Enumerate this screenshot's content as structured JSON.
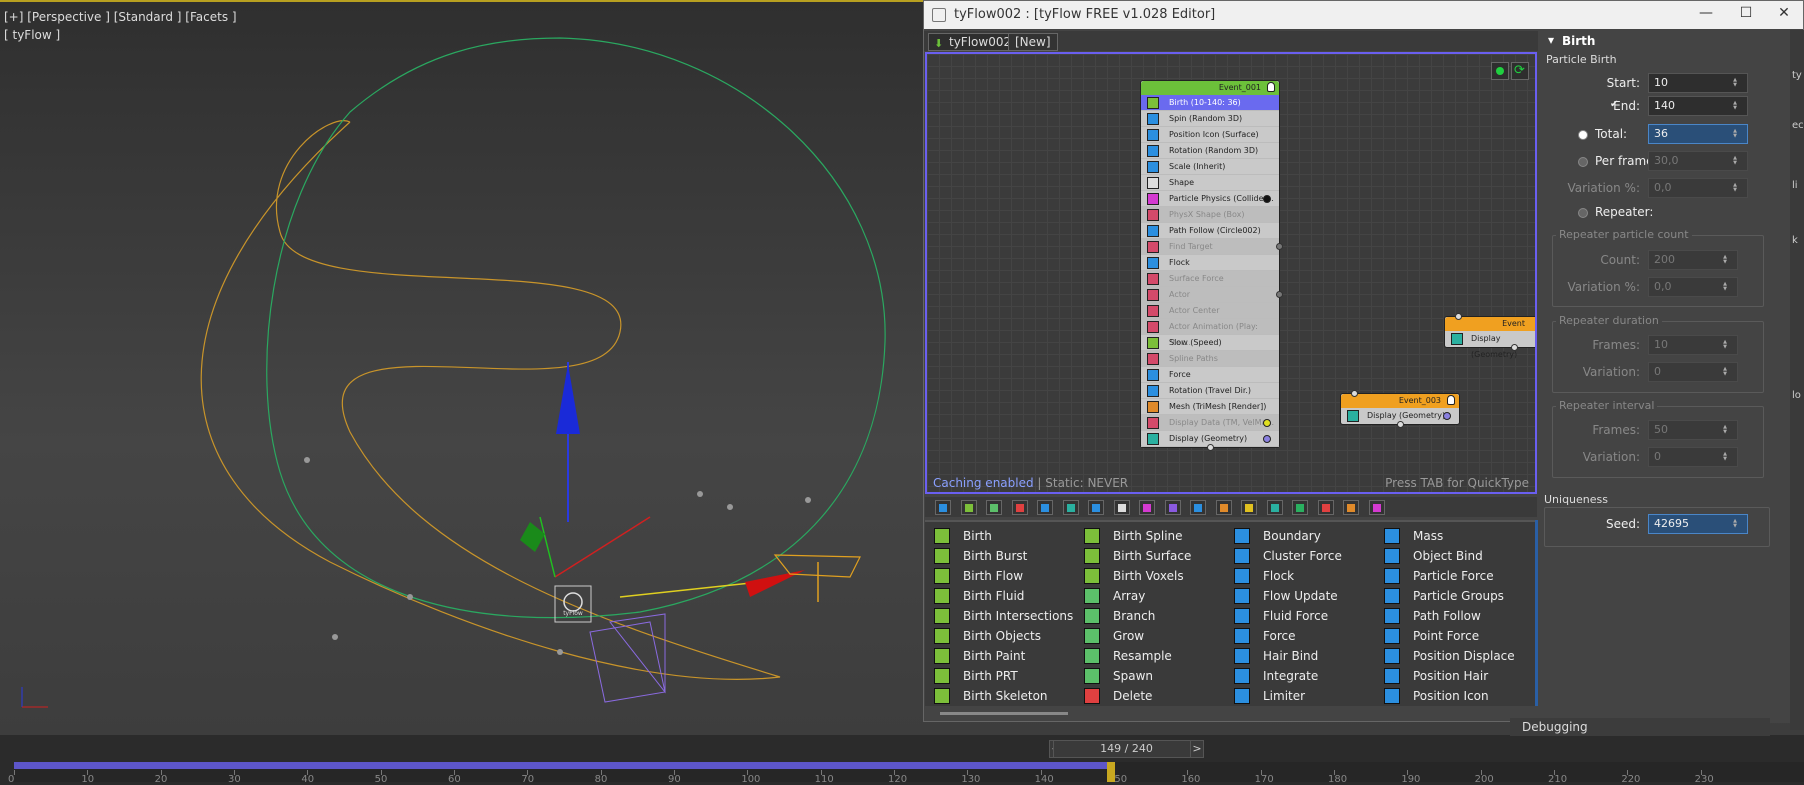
{
  "viewport": {
    "label": "[+] [Perspective ] [Standard ] [Facets ]",
    "sublabel": "[ tyFlow ]",
    "icon_label": "tyFlow"
  },
  "timeline": {
    "frame_display": "149 / 240",
    "prev": "<",
    "next": ">",
    "current_frame": 149,
    "total_frames": 240,
    "ticks": [
      "0",
      "10",
      "20",
      "30",
      "40",
      "50",
      "60",
      "70",
      "80",
      "90",
      "100",
      "110",
      "120",
      "130",
      "140",
      "150",
      "160",
      "170",
      "180",
      "190",
      "200",
      "210",
      "220",
      "230"
    ]
  },
  "window": {
    "title": "tyFlow002 : [tyFlow FREE v1.028 Editor]",
    "min": "—",
    "max": "☐",
    "close": "✕",
    "tabs": [
      "tyFlow002",
      "[New]"
    ]
  },
  "graph": {
    "footer_left_a": "Caching enabled",
    "footer_left_b": " | Static: NEVER",
    "footer_right": "Press TAB for QuickType",
    "event1": {
      "title": "Event_001",
      "color": "#6cc03a",
      "operators": [
        {
          "label": "Birth (10-140: 36)",
          "state": "sel",
          "icon": "#7cbf3a"
        },
        {
          "label": "Spin (Random 3D)",
          "state": "on",
          "icon": "#2b8fe0"
        },
        {
          "label": "Position Icon (Surface)",
          "state": "on",
          "icon": "#2b8fe0"
        },
        {
          "label": "Rotation (Random 3D)",
          "state": "on",
          "icon": "#2b8fe0"
        },
        {
          "label": "Scale (Inherit)",
          "state": "on",
          "icon": "#2b8fe0"
        },
        {
          "label": "Shape",
          "state": "on",
          "icon": "#dddddd"
        },
        {
          "label": "Particle Physics (Collide ...",
          "state": "on",
          "icon": "#d43ad0"
        },
        {
          "label": "PhysX Shape (Box)",
          "state": "dis",
          "icon": "#d44a6a"
        },
        {
          "label": "Path Follow (Circle002)",
          "state": "on",
          "icon": "#2b8fe0"
        },
        {
          "label": "Find Target",
          "state": "dis",
          "icon": "#d44a6a"
        },
        {
          "label": "Flock",
          "state": "on",
          "icon": "#2b8fe0"
        },
        {
          "label": "Surface Force",
          "state": "dis",
          "icon": "#d44a6a"
        },
        {
          "label": "Actor",
          "state": "dis",
          "icon": "#d44a6a"
        },
        {
          "label": "Actor Center",
          "state": "dis",
          "icon": "#d44a6a"
        },
        {
          "label": "Actor Animation (Play: \"ter...",
          "state": "dis",
          "icon": "#d44a6a"
        },
        {
          "label": "Slow (Speed)",
          "state": "on",
          "icon": "#7cbf3a"
        },
        {
          "label": "Spline Paths",
          "state": "dis",
          "icon": "#d44a6a"
        },
        {
          "label": "Force",
          "state": "on",
          "icon": "#2b8fe0"
        },
        {
          "label": "Rotation (Travel Dir.)",
          "state": "on",
          "icon": "#2b8fe0"
        },
        {
          "label": "Mesh (TriMesh [Render])",
          "state": "on",
          "icon": "#e08a2a"
        },
        {
          "label": "Display Data (TM, VelMa...",
          "state": "dis",
          "icon": "#d44a6a"
        },
        {
          "label": "Display (Geometry)",
          "state": "on",
          "icon": "#2ab0a0"
        }
      ]
    },
    "event2": {
      "title": "Event",
      "color": "#f0a020",
      "op": "Display (Geometry)"
    },
    "event3": {
      "title": "Event_003",
      "color": "#f0a020",
      "op": "Display (Geometry)"
    }
  },
  "operators_list": {
    "col1": [
      {
        "label": "Birth",
        "icon": "#7cbf3a"
      },
      {
        "label": "Birth Burst",
        "icon": "#7cbf3a"
      },
      {
        "label": "Birth Flow",
        "icon": "#7cbf3a"
      },
      {
        "label": "Birth Fluid",
        "icon": "#7cbf3a"
      },
      {
        "label": "Birth Intersections",
        "icon": "#7cbf3a"
      },
      {
        "label": "Birth Objects",
        "icon": "#7cbf3a"
      },
      {
        "label": "Birth Paint",
        "icon": "#7cbf3a"
      },
      {
        "label": "Birth PRT",
        "icon": "#7cbf3a"
      },
      {
        "label": "Birth Skeleton",
        "icon": "#7cbf3a"
      }
    ],
    "col2": [
      {
        "label": "Birth Spline",
        "icon": "#7cbf3a"
      },
      {
        "label": "Birth Surface",
        "icon": "#7cbf3a"
      },
      {
        "label": "Birth Voxels",
        "icon": "#7cbf3a"
      },
      {
        "label": "Array",
        "icon": "#5cc06a"
      },
      {
        "label": "Branch",
        "icon": "#5cc06a"
      },
      {
        "label": "Grow",
        "icon": "#5cc06a"
      },
      {
        "label": "Resample",
        "icon": "#5cc06a"
      },
      {
        "label": "Spawn",
        "icon": "#5cc06a"
      },
      {
        "label": "Delete",
        "icon": "#e04040"
      }
    ],
    "col3": [
      {
        "label": "Boundary",
        "icon": "#2b8fe0"
      },
      {
        "label": "Cluster Force",
        "icon": "#2b8fe0"
      },
      {
        "label": "Flock",
        "icon": "#2b8fe0"
      },
      {
        "label": "Flow Update",
        "icon": "#2b8fe0"
      },
      {
        "label": "Fluid Force",
        "icon": "#2b8fe0"
      },
      {
        "label": "Force",
        "icon": "#2b8fe0"
      },
      {
        "label": "Hair Bind",
        "icon": "#2b8fe0"
      },
      {
        "label": "Integrate",
        "icon": "#2b8fe0"
      },
      {
        "label": "Limiter",
        "icon": "#2b8fe0"
      }
    ],
    "col4": [
      {
        "label": "Mass",
        "icon": "#2b8fe0"
      },
      {
        "label": "Object Bind",
        "icon": "#2b8fe0"
      },
      {
        "label": "Particle Force",
        "icon": "#2b8fe0"
      },
      {
        "label": "Particle Groups",
        "icon": "#2b8fe0"
      },
      {
        "label": "Path Follow",
        "icon": "#2b8fe0"
      },
      {
        "label": "Point Force",
        "icon": "#2b8fe0"
      },
      {
        "label": "Position Displace",
        "icon": "#2b8fe0"
      },
      {
        "label": "Position Hair",
        "icon": "#2b8fe0"
      },
      {
        "label": "Position Icon",
        "icon": "#2b8fe0"
      }
    ],
    "toolbar_colors": [
      "#2b8fe0",
      "#7cbf3a",
      "#5cc06a",
      "#e04040",
      "#2b8fe0",
      "#2ab0a0",
      "#2b8fe0",
      "#dddddd",
      "#d43ad0",
      "#8a5ae0",
      "#2b8fe0",
      "#e08a2a",
      "#e0c020",
      "#2ab0a0",
      "#2ab060",
      "#e04040",
      "#e08a2a",
      "#d43ad0"
    ]
  },
  "panel": {
    "header": "Birth",
    "section": "Particle Birth",
    "start_label": "Start:",
    "start_value": "10",
    "end_label": "End:",
    "end_value": "140",
    "total_label": "Total:",
    "total_value": "36",
    "perframe_label": "Per frame:",
    "perframe_value": "30,0",
    "variation_label": "Variation %:",
    "variation_value": "0,0",
    "repeater_label": "Repeater:",
    "rpc_title": "Repeater particle count",
    "count_label": "Count:",
    "count_value": "200",
    "rpc_var_label": "Variation %:",
    "rpc_var_value": "0,0",
    "rd_title": "Repeater duration",
    "rd_frames_label": "Frames:",
    "rd_frames_value": "10",
    "rd_var_label": "Variation:",
    "rd_var_value": "0",
    "ri_title": "Repeater interval",
    "ri_frames_label": "Frames:",
    "ri_frames_value": "50",
    "ri_var_label": "Variation:",
    "ri_var_value": "0",
    "uniq_title": "Uniqueness",
    "seed_label": "Seed:",
    "seed_value": "42695"
  },
  "debugging": "Debugging"
}
